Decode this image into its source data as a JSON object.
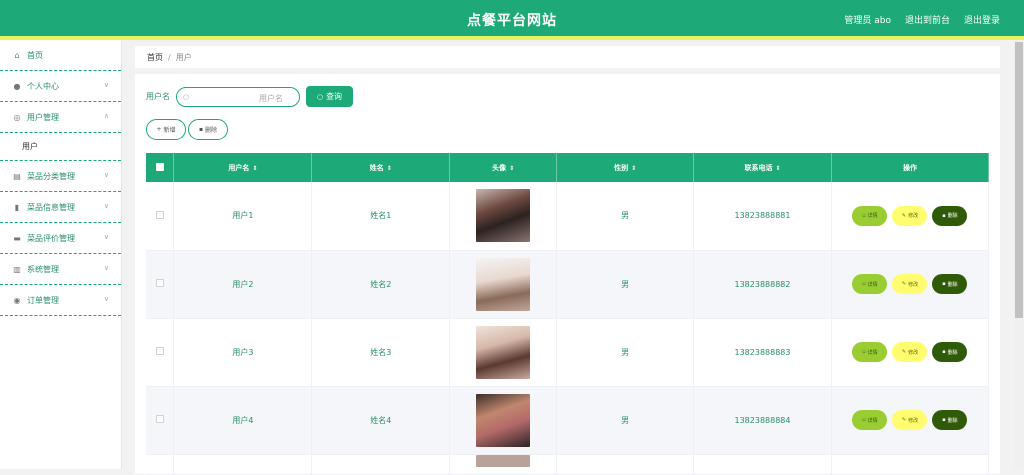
{
  "header": {
    "title": "点餐平台网站",
    "user_label": "管理员 abo",
    "back_label": "退出到前台",
    "logout_label": "退出登录"
  },
  "sidebar": {
    "items": [
      {
        "label": "首页",
        "icon": "home-icon"
      },
      {
        "label": "个人中心",
        "icon": "user-icon"
      },
      {
        "label": "用户管理",
        "icon": "users-icon"
      },
      {
        "label": "菜品分类管理",
        "icon": "category-icon"
      },
      {
        "label": "菜品信息管理",
        "icon": "document-icon"
      },
      {
        "label": "菜品评价管理",
        "icon": "comment-icon"
      },
      {
        "label": "系统管理",
        "icon": "chart-icon"
      },
      {
        "label": "订单管理",
        "icon": "order-icon"
      }
    ],
    "sub_item": "用户"
  },
  "breadcrumb": {
    "home": "首页",
    "sep": "/",
    "current": "用户"
  },
  "search": {
    "label": "用户名",
    "placeholder": "用户名",
    "button": "查询"
  },
  "actions": {
    "add": "新增",
    "delete": "删除"
  },
  "table": {
    "headers": [
      "用户名",
      "姓名",
      "头像",
      "性别",
      "联系电话",
      "操作"
    ],
    "rows": [
      {
        "username": "用户1",
        "name": "姓名1",
        "gender": "男",
        "phone": "13823888881"
      },
      {
        "username": "用户2",
        "name": "姓名2",
        "gender": "男",
        "phone": "13823888882"
      },
      {
        "username": "用户3",
        "name": "姓名3",
        "gender": "男",
        "phone": "13823888883"
      },
      {
        "username": "用户4",
        "name": "姓名4",
        "gender": "男",
        "phone": "13823888884"
      }
    ],
    "op_labels": {
      "detail": "详情",
      "edit": "修改",
      "delete": "删除"
    }
  },
  "colors": {
    "primary": "#1eaa78",
    "accent_bar": "#e9f25d",
    "detail": "#9acd32",
    "edit": "#fffd6f",
    "delete": "#2f5b08"
  }
}
